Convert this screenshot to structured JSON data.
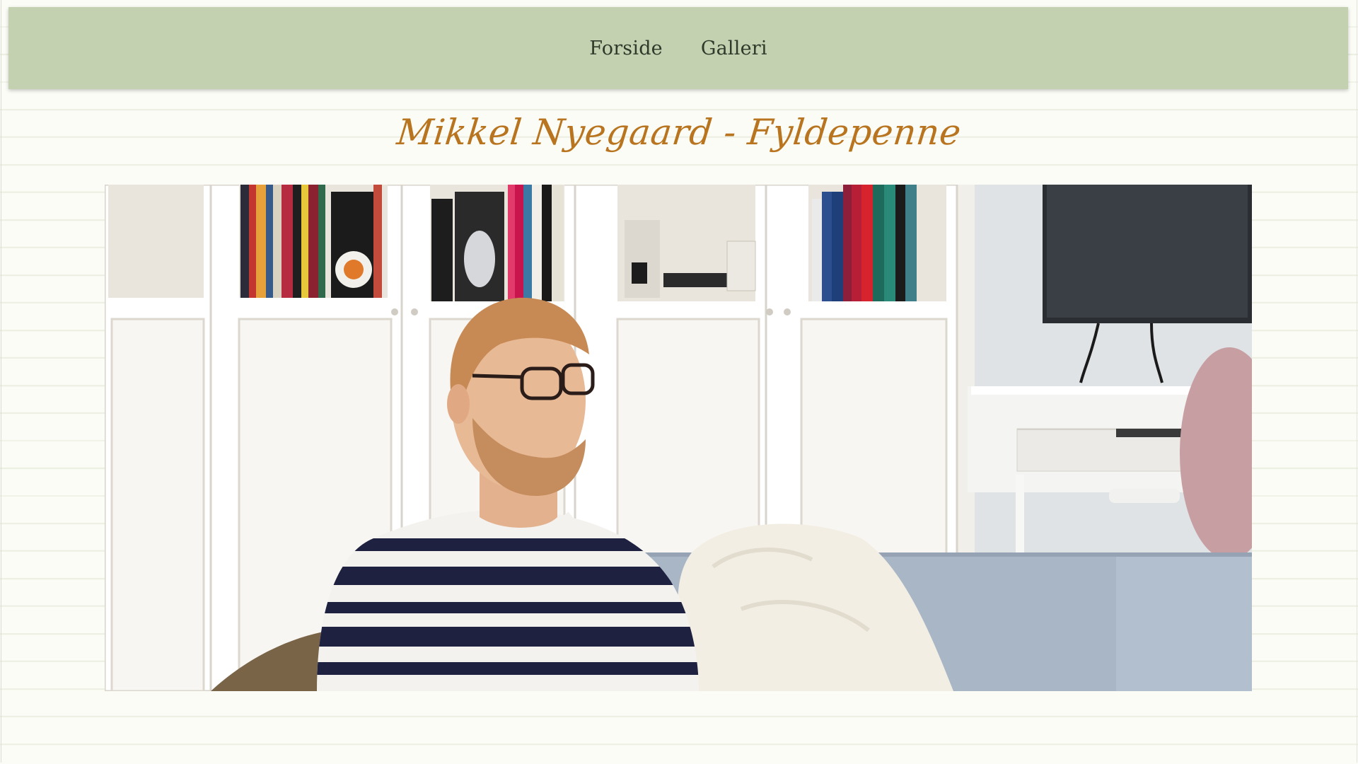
{
  "nav": {
    "items": [
      {
        "label": "Forside"
      },
      {
        "label": "Galleri"
      }
    ]
  },
  "header": {
    "title": "Mikkel Nyegaard - Fyldepenne"
  },
  "colors": {
    "page_background": "#fbfcf6",
    "navbar": "#c4d1b1",
    "nav_text": "#2f3a2a",
    "title": "#b8741e"
  },
  "hero": {
    "icon": "portrait-photo"
  }
}
